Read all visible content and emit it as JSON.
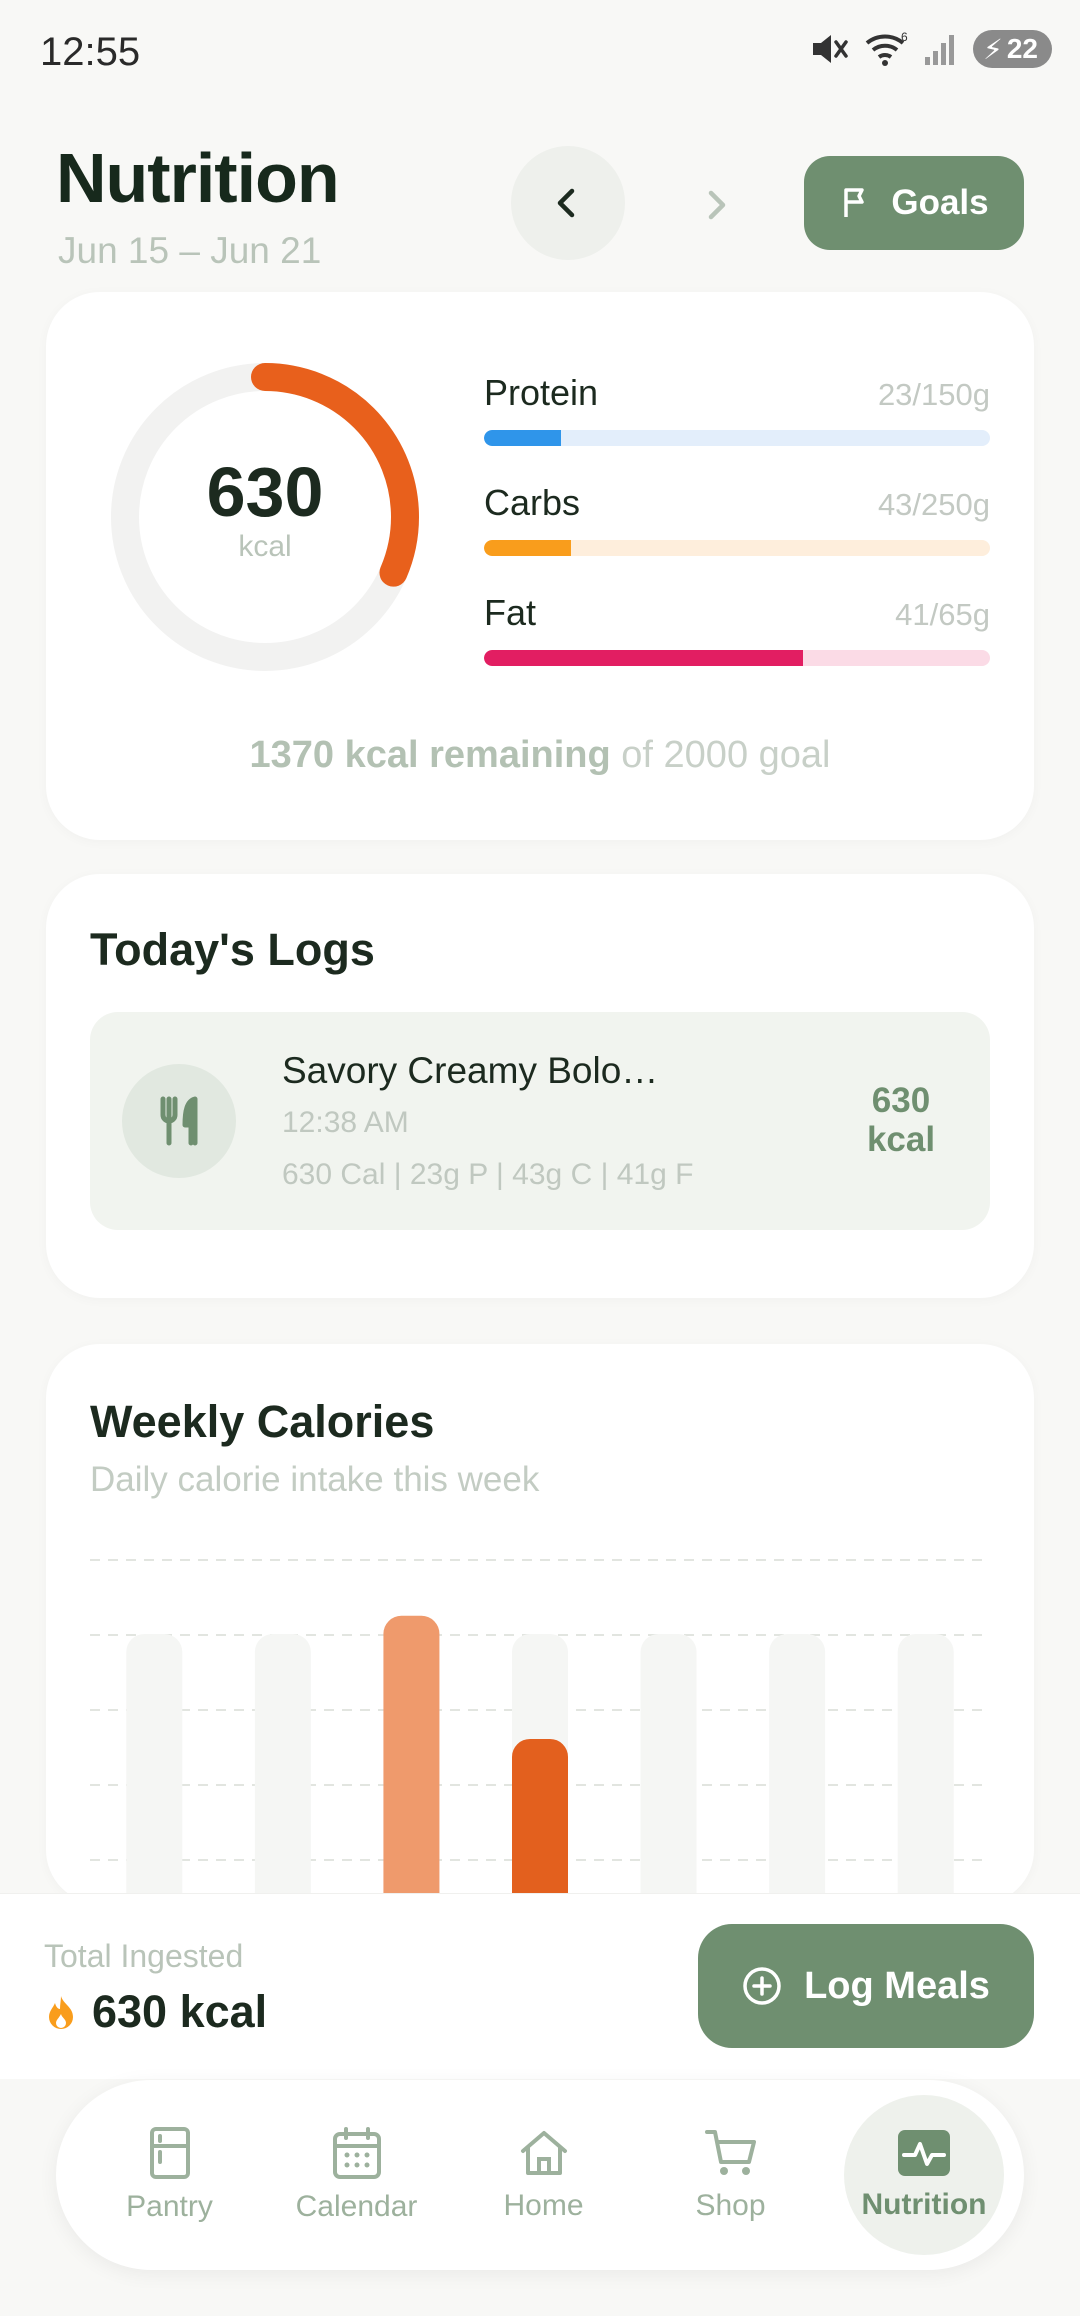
{
  "status": {
    "time": "12:55",
    "battery": "22",
    "signal_label": "6"
  },
  "header": {
    "title": "Nutrition",
    "date_range": "Jun 15 – Jun 21",
    "goals_label": "Goals"
  },
  "summary": {
    "calories": "630",
    "calories_unit": "kcal",
    "calories_progress": 0.315,
    "macros": [
      {
        "name": "Protein",
        "amount": "23/150g",
        "fraction": 0.153,
        "color": "#2f95ea",
        "track": "#e3eefb"
      },
      {
        "name": "Carbs",
        "amount": "43/250g",
        "fraction": 0.172,
        "color": "#f99d1c",
        "track": "#feeedc"
      },
      {
        "name": "Fat",
        "amount": "41/65g",
        "fraction": 0.631,
        "color": "#e21e62",
        "track": "#fbdbe6"
      }
    ],
    "remaining_strong": "1370 kcal remaining",
    "remaining_rest": " of 2000 goal"
  },
  "logs": {
    "title": "Today's Logs",
    "items": [
      {
        "name": "Savory Creamy Bologna & E…",
        "time": "12:38 AM",
        "macros": "630 Cal | 23g P | 43g C | 41g F",
        "kcal_value": "630",
        "kcal_unit": "kcal"
      }
    ]
  },
  "weekly": {
    "title": "Weekly Calories",
    "subtitle": "Daily calorie intake this week"
  },
  "chart_data": {
    "type": "bar",
    "categories": [
      "",
      "",
      "",
      "",
      "",
      "",
      ""
    ],
    "values": [
      0,
      0,
      1100,
      630,
      0,
      0,
      0
    ],
    "ylim": [
      0,
      2000
    ],
    "grid": true,
    "colors": [
      "#f0e9e4",
      "#f0e9e4",
      "#ef9a6c",
      "#e3601e",
      "#f0e9e4",
      "#f0e9e4",
      "#f0e9e4"
    ]
  },
  "footer": {
    "total_label": "Total Ingested",
    "total_value": "630 kcal",
    "log_meals_label": "Log Meals"
  },
  "tabs": [
    {
      "label": "Pantry",
      "icon": "pantry-icon"
    },
    {
      "label": "Calendar",
      "icon": "calendar-icon"
    },
    {
      "label": "Home",
      "icon": "home-icon"
    },
    {
      "label": "Shop",
      "icon": "cart-icon"
    },
    {
      "label": "Nutrition",
      "icon": "activity-icon",
      "active": true
    }
  ],
  "colors": {
    "accent": "#6f8f70",
    "calorie_ring": "#e8601c"
  }
}
